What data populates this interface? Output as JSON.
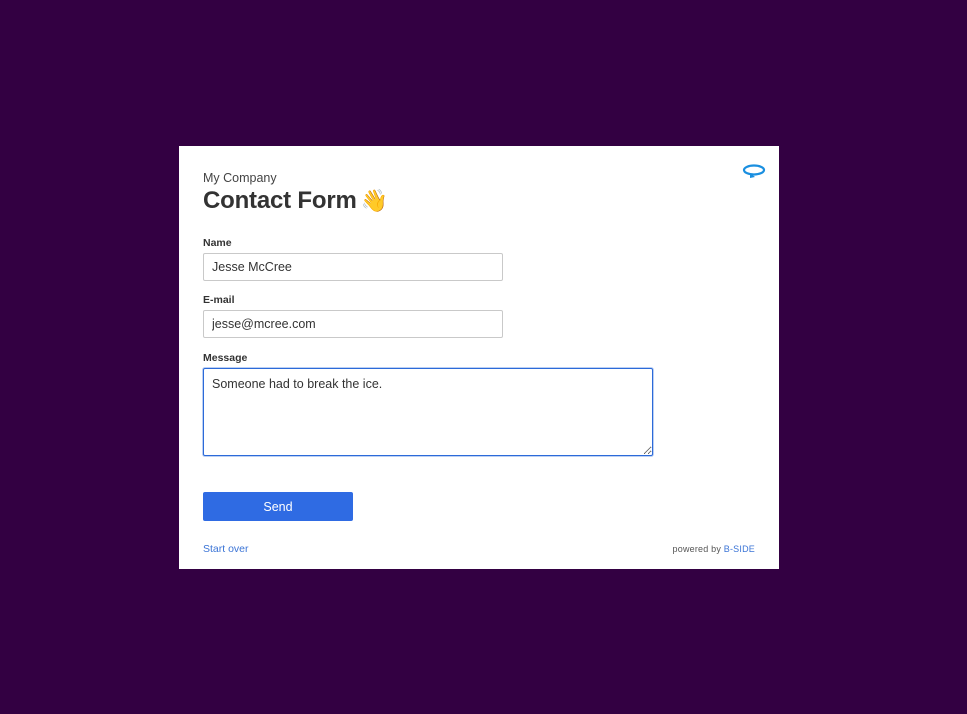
{
  "form": {
    "company": "My Company",
    "title": "Contact Form",
    "title_emoji": "👋",
    "restart_icon": "rotate-icon",
    "fields": {
      "name_label": "Name",
      "name_value": "Jesse McCree",
      "email_label": "E-mail",
      "email_value": "jesse@mcree.com",
      "message_label": "Message",
      "message_value": "Someone had to break the ice."
    },
    "send_label": "Send",
    "start_over_label": "Start over",
    "powered_prefix": "powered by",
    "powered_brand": "B-SIDE"
  },
  "colors": {
    "background": "#330042",
    "accent": "#2f6be3",
    "link": "#3b74d6"
  }
}
